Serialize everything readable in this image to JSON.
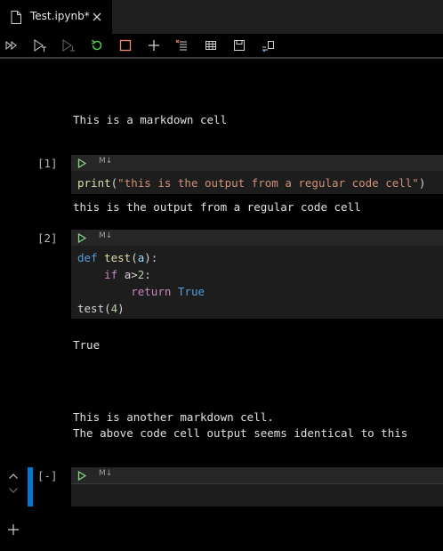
{
  "tab": {
    "title": "Test.ipynb*",
    "icons": {
      "file": "file-icon",
      "close": "close-icon"
    }
  },
  "toolbar": {
    "buttons": [
      {
        "name": "run-all-icon"
      },
      {
        "name": "run-below-icon"
      },
      {
        "name": "run-above-icon"
      },
      {
        "name": "restart-kernel-icon"
      },
      {
        "name": "interrupt-kernel-icon"
      },
      {
        "name": "add-cell-icon"
      },
      {
        "name": "clear-outputs-icon"
      },
      {
        "name": "variables-icon"
      },
      {
        "name": "save-icon"
      },
      {
        "name": "export-icon"
      }
    ]
  },
  "cells": {
    "markdown1": "This is a markdown cell",
    "code1": {
      "count": "[1]",
      "md_label": "M↓",
      "source": "print(\"this is the output from a regular code cell\")",
      "output": "this is the output from a regular code cell"
    },
    "code2": {
      "count": "[2]",
      "md_label": "M↓",
      "line1": "def test(a):",
      "line2": "    if a>2:",
      "line3": "        return True",
      "line4": "test(4)",
      "output": "True"
    },
    "markdown2": {
      "line1": "This is another markdown cell.",
      "line2": "The above code cell output seems identical to this"
    },
    "code3": {
      "count": "[-]",
      "md_label": "M↓"
    }
  },
  "colors": {
    "accent": "#0078d4",
    "run_green": "#89d185",
    "restart_green": "#4ec94e",
    "interrupt_red": "#f48771"
  }
}
